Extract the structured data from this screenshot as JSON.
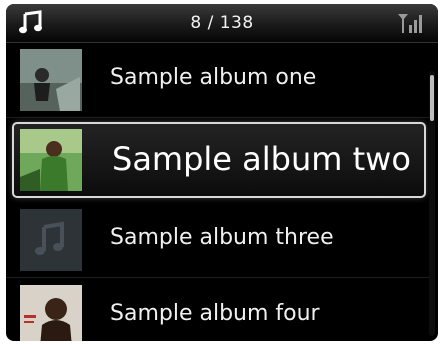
{
  "header": {
    "counter": "8 / 138",
    "left_icon": "music-note-icon",
    "right_icon": "signal-strength-icon"
  },
  "albums": [
    {
      "label": "Sample album one",
      "selected": false,
      "art": "photo-art"
    },
    {
      "label": "Sample album two",
      "selected": true,
      "art": "photo-art"
    },
    {
      "label": "Sample album three",
      "selected": false,
      "art": "placeholder-music-note"
    },
    {
      "label": "Sample album four",
      "selected": false,
      "art": "photo-art"
    }
  ],
  "colors": {
    "background": "#000000",
    "text": "#f0f0f0",
    "selection_border": "#d8d8d8"
  }
}
